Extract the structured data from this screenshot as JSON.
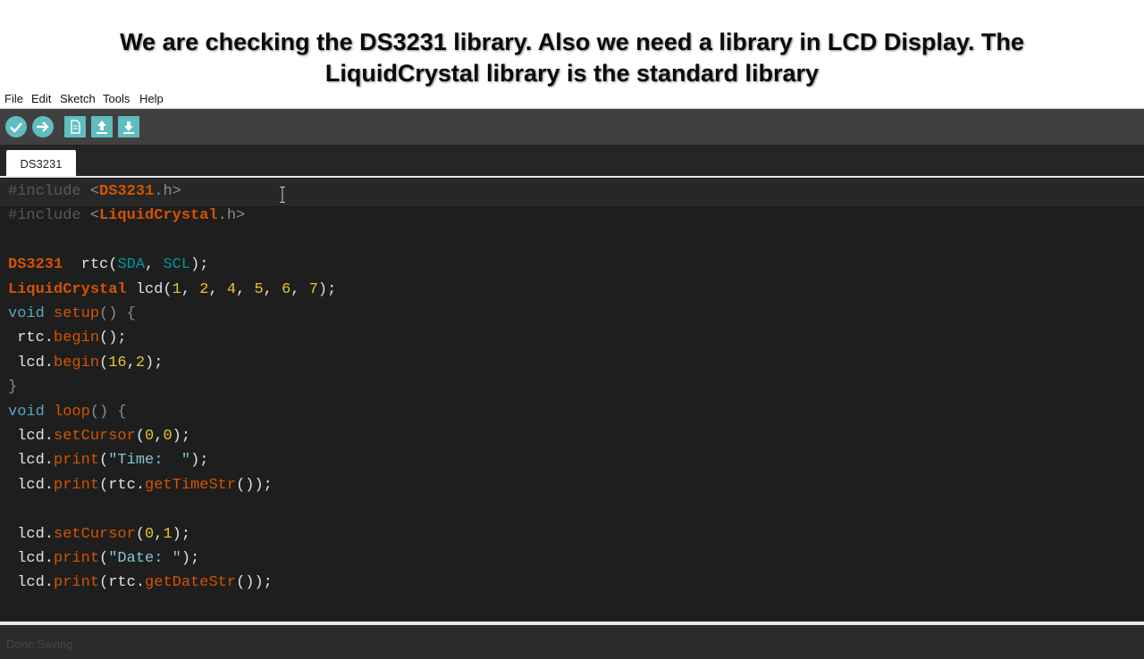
{
  "caption": {
    "line1": "We are checking the DS3231 library. Also we need a library in LCD Display. The",
    "line2": "LiquidCrystal library is the standard library"
  },
  "menu": {
    "items": [
      "File",
      "Edit",
      "Sketch",
      "Tools",
      "Help"
    ]
  },
  "toolbar": {
    "buttons": [
      {
        "icon": "verify-icon"
      },
      {
        "icon": "upload-arrow-icon"
      },
      {
        "icon": "new-file-icon"
      },
      {
        "icon": "open-icon"
      },
      {
        "icon": "save-icon"
      }
    ]
  },
  "tabs": [
    {
      "label": "DS3231"
    }
  ],
  "editor": {
    "lines": [
      [
        {
          "t": "#include ",
          "c": "cm"
        },
        {
          "t": "<",
          "c": "pu"
        },
        {
          "t": "DS3231",
          "c": "ty"
        },
        {
          "t": ".h>",
          "c": "pu"
        }
      ],
      [
        {
          "t": "#include ",
          "c": "cm"
        },
        {
          "t": "<",
          "c": "pu"
        },
        {
          "t": "LiquidCrystal",
          "c": "ty"
        },
        {
          "t": ".h>",
          "c": "pu"
        }
      ],
      [],
      [
        {
          "t": "DS3231",
          "c": "ty"
        },
        {
          "t": "  rtc(",
          "c": ""
        },
        {
          "t": "SDA",
          "c": "cs"
        },
        {
          "t": ", ",
          "c": ""
        },
        {
          "t": "SCL",
          "c": "cs"
        },
        {
          "t": ");",
          "c": ""
        }
      ],
      [
        {
          "t": "LiquidCrystal",
          "c": "ty"
        },
        {
          "t": " lcd(",
          "c": ""
        },
        {
          "t": "1",
          "c": "nm"
        },
        {
          "t": ", ",
          "c": ""
        },
        {
          "t": "2",
          "c": "nm"
        },
        {
          "t": ", ",
          "c": ""
        },
        {
          "t": "4",
          "c": "nm"
        },
        {
          "t": ", ",
          "c": ""
        },
        {
          "t": "5",
          "c": "nm"
        },
        {
          "t": ", ",
          "c": ""
        },
        {
          "t": "6",
          "c": "nm"
        },
        {
          "t": ", ",
          "c": ""
        },
        {
          "t": "7",
          "c": "nm"
        },
        {
          "t": ");",
          "c": ""
        }
      ],
      [
        {
          "t": "void",
          "c": "kw"
        },
        {
          "t": " ",
          "c": ""
        },
        {
          "t": "setup",
          "c": "fn"
        },
        {
          "t": "() {",
          "c": "pu"
        }
      ],
      [
        {
          "t": " rtc.",
          "c": ""
        },
        {
          "t": "begin",
          "c": "fn"
        },
        {
          "t": "();",
          "c": ""
        }
      ],
      [
        {
          "t": " lcd.",
          "c": ""
        },
        {
          "t": "begin",
          "c": "fn"
        },
        {
          "t": "(",
          "c": ""
        },
        {
          "t": "16",
          "c": "nm"
        },
        {
          "t": ",",
          "c": ""
        },
        {
          "t": "2",
          "c": "nm"
        },
        {
          "t": ");",
          "c": ""
        }
      ],
      [
        {
          "t": "}",
          "c": "pu"
        }
      ],
      [
        {
          "t": "void",
          "c": "kw"
        },
        {
          "t": " ",
          "c": ""
        },
        {
          "t": "loop",
          "c": "fn"
        },
        {
          "t": "() {",
          "c": "pu"
        }
      ],
      [
        {
          "t": " lcd.",
          "c": ""
        },
        {
          "t": "setCursor",
          "c": "fn"
        },
        {
          "t": "(",
          "c": ""
        },
        {
          "t": "0",
          "c": "nm"
        },
        {
          "t": ",",
          "c": ""
        },
        {
          "t": "0",
          "c": "nm"
        },
        {
          "t": ");",
          "c": ""
        }
      ],
      [
        {
          "t": " lcd.",
          "c": ""
        },
        {
          "t": "print",
          "c": "fn"
        },
        {
          "t": "(",
          "c": ""
        },
        {
          "t": "\"Time:  \"",
          "c": "st"
        },
        {
          "t": ");",
          "c": ""
        }
      ],
      [
        {
          "t": " lcd.",
          "c": ""
        },
        {
          "t": "print",
          "c": "fn"
        },
        {
          "t": "(rtc.",
          "c": ""
        },
        {
          "t": "getTimeStr",
          "c": "fn"
        },
        {
          "t": "());",
          "c": ""
        }
      ],
      [],
      [
        {
          "t": " lcd.",
          "c": ""
        },
        {
          "t": "setCursor",
          "c": "fn"
        },
        {
          "t": "(",
          "c": ""
        },
        {
          "t": "0",
          "c": "nm"
        },
        {
          "t": ",",
          "c": ""
        },
        {
          "t": "1",
          "c": "nm"
        },
        {
          "t": ");",
          "c": ""
        }
      ],
      [
        {
          "t": " lcd.",
          "c": ""
        },
        {
          "t": "print",
          "c": "fn"
        },
        {
          "t": "(",
          "c": ""
        },
        {
          "t": "\"Date: \"",
          "c": "st"
        },
        {
          "t": ");",
          "c": ""
        }
      ],
      [
        {
          "t": " lcd.",
          "c": ""
        },
        {
          "t": "print",
          "c": "fn"
        },
        {
          "t": "(rtc.",
          "c": ""
        },
        {
          "t": "getDateStr",
          "c": "fn"
        },
        {
          "t": "());",
          "c": ""
        }
      ]
    ]
  },
  "status": {
    "message": "Done Saving"
  },
  "colors": {
    "toolbar_button": "#5fbcc0",
    "editor_bg": "#1e1e1e",
    "type": "#d35400",
    "keyword": "#53a8bf",
    "number": "#e8c62a"
  }
}
